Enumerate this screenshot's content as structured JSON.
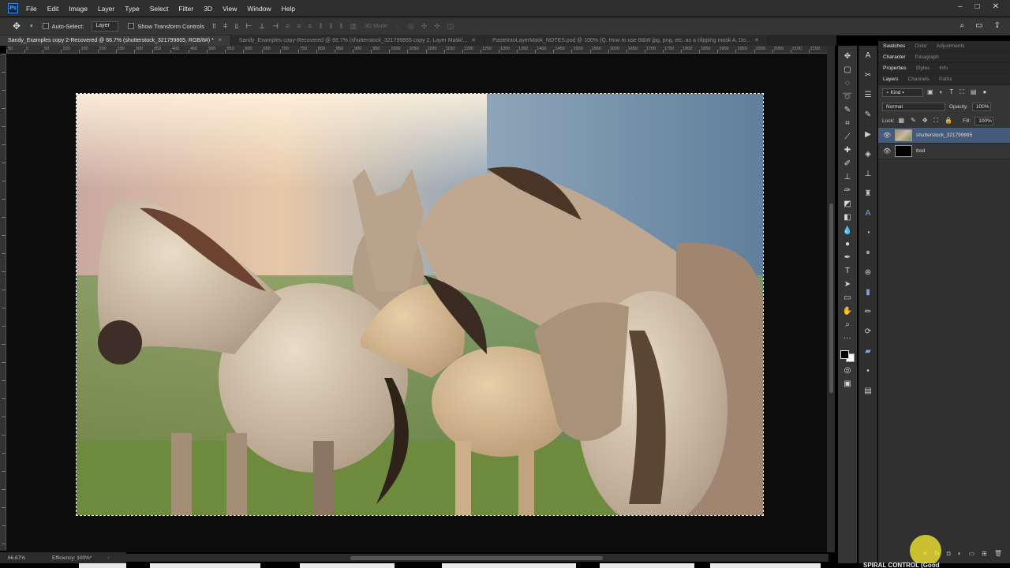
{
  "app": {
    "logo": "Ps",
    "menu": [
      "File",
      "Edit",
      "Image",
      "Layer",
      "Type",
      "Select",
      "Filter",
      "3D",
      "View",
      "Window",
      "Help"
    ],
    "window_controls": [
      "–",
      "□",
      "✕"
    ]
  },
  "options_bar": {
    "auto_select_label": "Auto-Select:",
    "auto_select_value": "Layer",
    "show_transform_label": "Show Transform Controls",
    "mode_3d_label": "3D Mode:"
  },
  "tabs": [
    {
      "label": "Sandy_Examples copy 2-Recovered @ 66.7% (shutterstock_321799865, RGB/8#) *",
      "active": true
    },
    {
      "label": "Sandy_Examples copy-Recovered @ 66.7% (shutterstock_321799865 copy 2, Layer Mask/...",
      "active": false
    },
    {
      "label": "PasteIntoLayerMask_NOTES.psd @ 100% (Q. How to use B&W jpg, png, etc. as a clipping mask   A. Do...",
      "active": false
    }
  ],
  "ruler_labels": [
    "50",
    "0",
    "50",
    "100",
    "150",
    "200",
    "250",
    "300",
    "350",
    "400",
    "450",
    "500",
    "550",
    "600",
    "650",
    "700",
    "750",
    "800",
    "850",
    "900",
    "950",
    "1000",
    "1050",
    "1100",
    "1150",
    "1200",
    "1250",
    "1300",
    "1350",
    "1400",
    "1450",
    "1500",
    "1550",
    "1600",
    "1650",
    "1700",
    "1750",
    "1800",
    "1850",
    "1900",
    "1950",
    "2000",
    "2050",
    "2100",
    "2150"
  ],
  "status": {
    "zoom": "66.67%",
    "efficiency": "Efficiency: 100%*"
  },
  "panels": {
    "top_tabs": [
      "Swatches",
      "Color",
      "Adjustments"
    ],
    "second_tabs": [
      "Character",
      "Paragraph"
    ],
    "third_tabs": [
      "Properties",
      "Styles",
      "Info"
    ],
    "layer_tabs": [
      "Layers",
      "Channels",
      "Paths"
    ],
    "kind_label": "Kind",
    "blend_mode": "Normal",
    "opacity_label": "Opacity:",
    "opacity_value": "100%",
    "lock_label": "Lock:",
    "fill_label": "Fill:",
    "fill_value": "100%",
    "layers": [
      {
        "name": "shutterstock_321799865",
        "selected": true
      },
      {
        "name": "fred",
        "selected": false
      }
    ]
  },
  "caption": "SPIRAL CONTROL (Good"
}
